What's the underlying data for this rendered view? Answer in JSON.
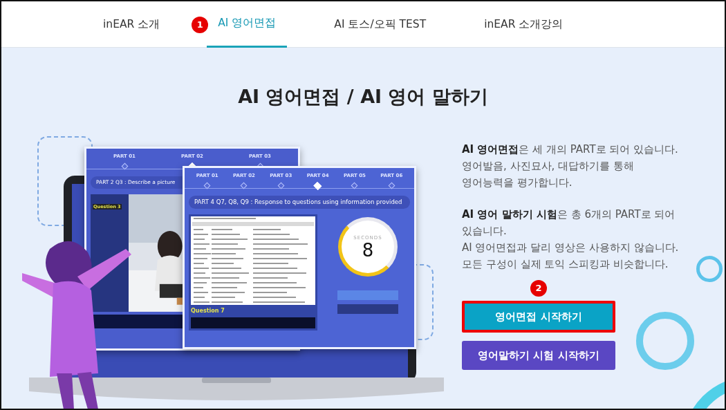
{
  "nav": {
    "tabs": [
      {
        "label": "inEAR 소개",
        "selected": false
      },
      {
        "label": "AI 영어면접",
        "selected": true,
        "marker": "1"
      },
      {
        "label": "AI 토스/오픽 TEST",
        "selected": false
      },
      {
        "label": "inEAR 소개강의",
        "selected": false
      }
    ]
  },
  "hero": {
    "title": "AI 영어면접 / AI 영어 말하기",
    "illustration": {
      "back_screen": {
        "steps": [
          {
            "label": "PART 01",
            "current": false
          },
          {
            "label": "PART 02",
            "current": true
          },
          {
            "label": "PART 03",
            "current": false
          }
        ],
        "heading": "PART 2  Q3 : Describe a picture",
        "question_tag": "Question 3"
      },
      "front_screen": {
        "steps": [
          {
            "label": "PART 01",
            "current": false
          },
          {
            "label": "PART 02",
            "current": false
          },
          {
            "label": "PART 03",
            "current": false
          },
          {
            "label": "PART 04",
            "current": true
          },
          {
            "label": "PART 05",
            "current": false
          },
          {
            "label": "PART 06",
            "current": false
          }
        ],
        "heading": "PART 4  Q7, Q8, Q9 : Response to questions using information provided",
        "timer_caption": "SECONDS",
        "timer_value": "8",
        "question_tag": "Question 7"
      }
    },
    "paragraphs": [
      {
        "lines": [
          "**AI 영어면접**은 세 개의 PART로 되어 있습니다.",
          "영어발음, 사진묘사, 대답하기를 통해",
          "영어능력을 평가합니다."
        ]
      },
      {
        "lines": [
          "**AI 영어 말하기 시험**은 총 6개의 PART로 되어",
          "있습니다.",
          "AI 영어면접과 달리 영상은 사용하지 않습니다.",
          "모든 구성이 실제 토익 스피킹과 비슷합니다."
        ]
      }
    ],
    "buttons": [
      {
        "label": "영어면접 시작하기",
        "kind": "interview",
        "highlighted": true,
        "marker": "2"
      },
      {
        "label": "영어말하기 시험 시작하기",
        "kind": "speaking",
        "highlighted": false
      }
    ]
  }
}
